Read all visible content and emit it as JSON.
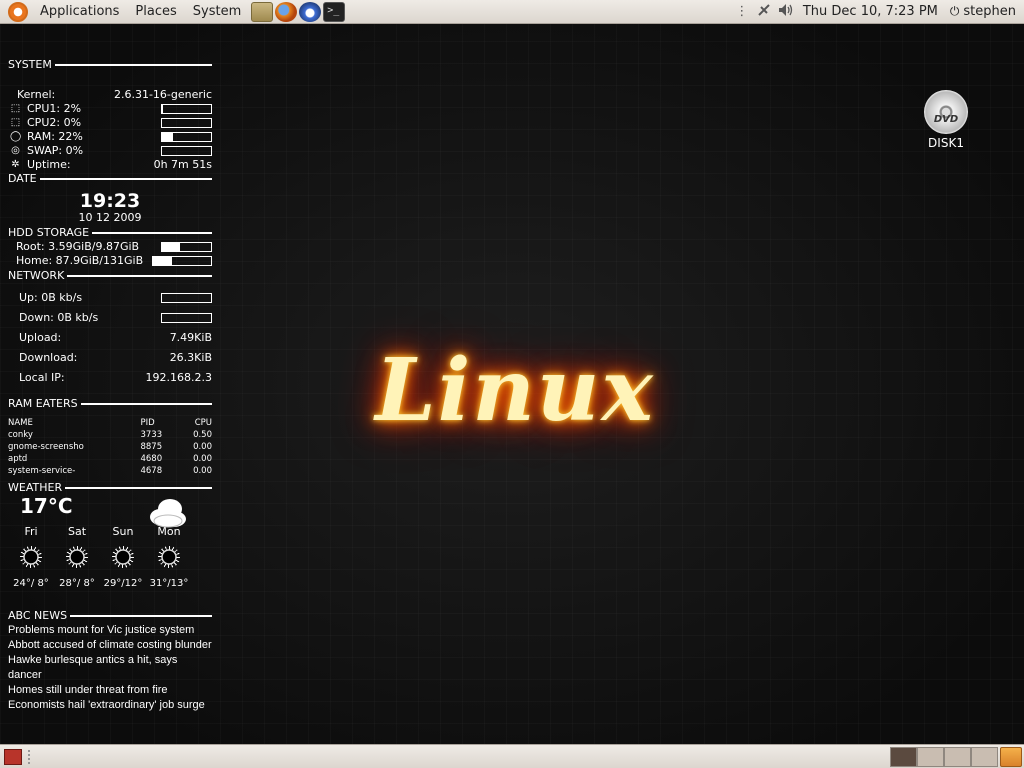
{
  "top_panel": {
    "menus": [
      "Applications",
      "Places",
      "System"
    ],
    "terminal_glyph": ">_",
    "clock": "Thu Dec 10,  7:23 PM",
    "user": "stephen"
  },
  "conky": {
    "system": {
      "header": "SYSTEM",
      "kernel_label": "Kernel:",
      "kernel_value": "2.6.31-16-generic",
      "cpu1": "CPU1: 2%",
      "cpu1_level": 0.02,
      "cpu2": "CPU2: 0%",
      "cpu2_level": 0.0,
      "ram": "RAM: 22%",
      "ram_level": 0.22,
      "swap": "SWAP: 0%",
      "swap_level": 0.0,
      "uptime_label": "Uptime:",
      "uptime_value": "0h 7m 51s"
    },
    "date": {
      "header": "DATE",
      "time": "19:23",
      "date": "10 12 2009"
    },
    "hdd": {
      "header": "HDD STORAGE",
      "root": "Root: 3.59GiB/9.87GiB",
      "root_level": 0.36,
      "home": "Home: 87.9GiB/131GiB",
      "home_level": 0.33
    },
    "network": {
      "header": "NETWORK",
      "up": "Up: 0B   kb/s",
      "down": "Down: 0B   kb/s",
      "upload_label": "Upload:",
      "upload_value": "7.49KiB",
      "download_label": "Download:",
      "download_value": "26.3KiB",
      "ip_label": "Local IP:",
      "ip_value": "192.168.2.3"
    },
    "ram_eaters": {
      "header": "RAM EATERS",
      "columns": [
        "NAME",
        "PID",
        "CPU"
      ],
      "rows": [
        [
          "conky",
          "3733",
          "0.50"
        ],
        [
          "gnome-screensho",
          "8875",
          "0.00"
        ],
        [
          "aptd",
          "4680",
          "0.00"
        ],
        [
          "system-service-",
          "4678",
          "0.00"
        ]
      ]
    },
    "weather": {
      "header": "WEATHER",
      "current_temp": "17°C",
      "days": [
        "Fri",
        "Sat",
        "Sun",
        "Mon"
      ],
      "temps": [
        "24°/ 8°",
        "28°/ 8°",
        "29°/12°",
        "31°/13°"
      ]
    },
    "news": {
      "header": "ABC NEWS",
      "items": [
        "Problems mount for Vic justice system",
        "Abbott accused of climate costing blunder",
        "Hawke burlesque antics a hit, says dancer",
        "Homes still under threat from fire",
        "Economists hail 'extraordinary' job surge"
      ]
    }
  },
  "desktop": {
    "dvd_badge": "DVD",
    "dvd_label": "DISK1",
    "logo_text": "Linux"
  }
}
